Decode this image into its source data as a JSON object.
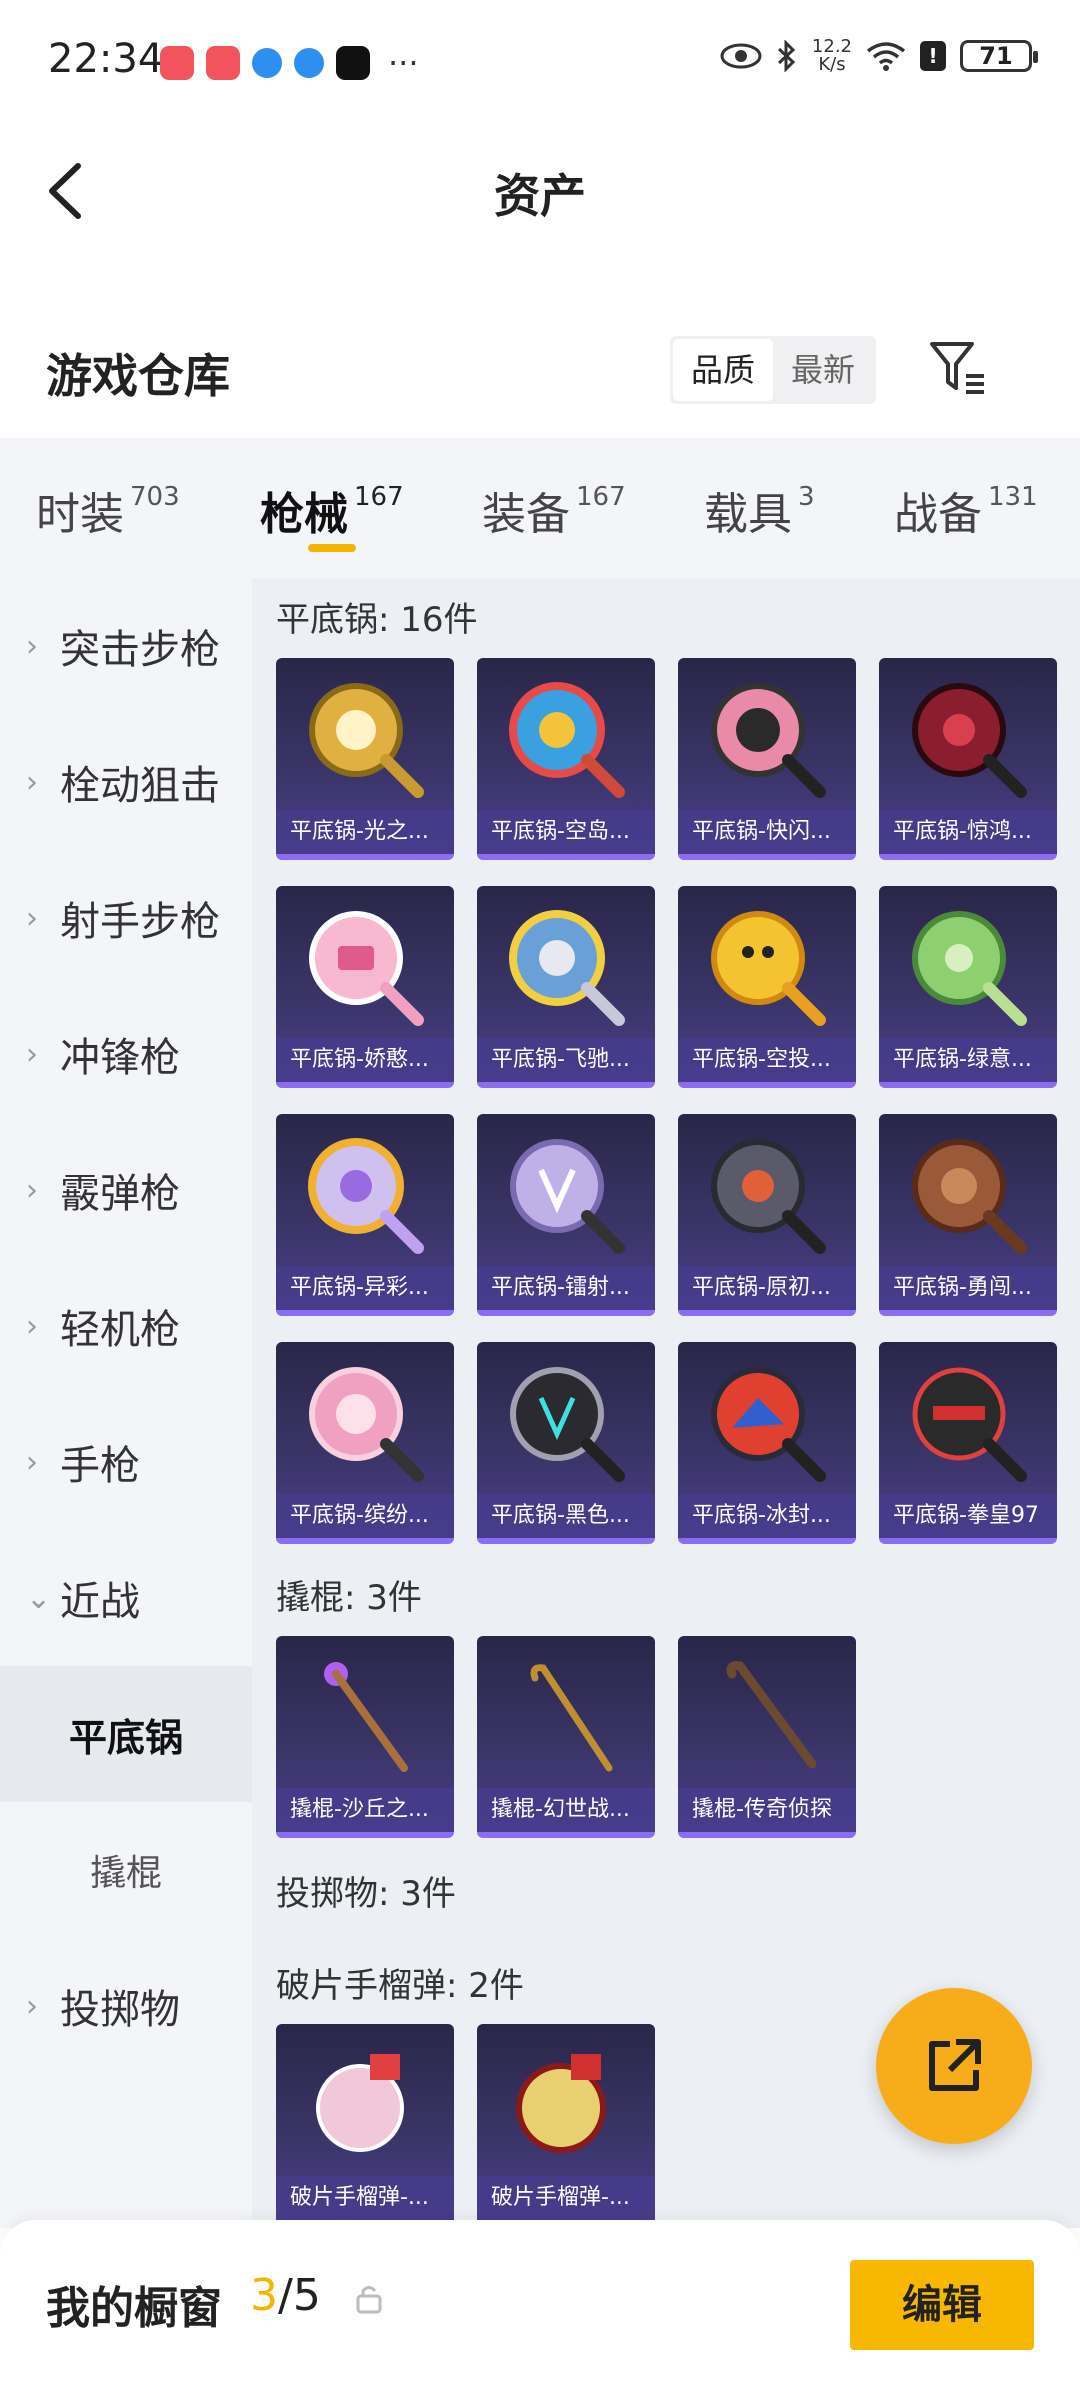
{
  "status_bar": {
    "time": "22:34",
    "speed_top": "12.2",
    "speed_bottom": "K/s",
    "battery": "71",
    "more": "···"
  },
  "header": {
    "title": "资产",
    "back_icon": "chevron-left-icon"
  },
  "warehouse": {
    "title": "游戏仓库",
    "sort_options": [
      "品质",
      "最新"
    ],
    "active_sort": "品质"
  },
  "tabs": [
    {
      "label": "时装",
      "count": "703"
    },
    {
      "label": "枪械",
      "count": "167"
    },
    {
      "label": "装备",
      "count": "167"
    },
    {
      "label": "载具",
      "count": "3"
    },
    {
      "label": "战备",
      "count": "131"
    }
  ],
  "sidebar": {
    "items": [
      {
        "label": "突击步枪"
      },
      {
        "label": "栓动狙击"
      },
      {
        "label": "射手步枪"
      },
      {
        "label": "冲锋枪"
      },
      {
        "label": "霰弹枪"
      },
      {
        "label": "轻机枪"
      },
      {
        "label": "手枪"
      },
      {
        "label": "近战"
      }
    ],
    "sub_items": [
      {
        "label": "平底锅"
      },
      {
        "label": "撬棍"
      }
    ],
    "last_item": {
      "label": "投掷物"
    }
  },
  "sections": {
    "pan": {
      "title": "平底锅: 16件",
      "items": [
        "平底锅-光之...",
        "平底锅-空岛...",
        "平底锅-快闪...",
        "平底锅-惊鸿...",
        "平底锅-娇憨...",
        "平底锅-飞驰...",
        "平底锅-空投...",
        "平底锅-绿意...",
        "平底锅-异彩...",
        "平底锅-镭射...",
        "平底锅-原初...",
        "平底锅-勇闯...",
        "平底锅-缤纷...",
        "平底锅-黑色...",
        "平底锅-冰封...",
        "平底锅-拳皇97"
      ]
    },
    "crowbar": {
      "title": "撬棍: 3件",
      "items": [
        "撬棍-沙丘之...",
        "撬棍-幻世战...",
        "撬棍-传奇侦探"
      ]
    },
    "throwables": {
      "title": "投掷物: 3件"
    },
    "grenade": {
      "title": "破片手榴弹: 2件",
      "items": [
        "破片手榴弹-...",
        "破片手榴弹-..."
      ]
    }
  },
  "bottom": {
    "title": "我的橱窗",
    "current": "3",
    "separator": "/",
    "total": "5",
    "edit_label": "编辑"
  },
  "colors": {
    "accent": "#f5b400",
    "card_border": "#8c6cf0",
    "fab": "#f7ac1a"
  }
}
